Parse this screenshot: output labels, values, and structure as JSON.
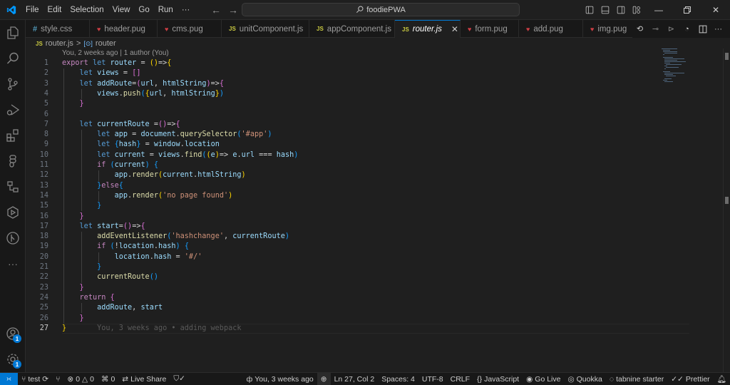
{
  "titlebar": {
    "menu": [
      "File",
      "Edit",
      "Selection",
      "View",
      "Go",
      "Run",
      "···"
    ],
    "search_text": "foodiePWA",
    "icons": [
      "toggle-primary-sidebar-icon",
      "toggle-panel-icon",
      "toggle-secondary-sidebar-icon",
      "customize-layout-icon",
      "minimize-icon",
      "restore-icon",
      "close-icon"
    ]
  },
  "activitybar": {
    "items": [
      "explorer",
      "search",
      "source-control",
      "run-and-debug",
      "extensions",
      "figma",
      "remote-explorer",
      "live-share-panel",
      "git-graph",
      "more"
    ],
    "accounts_badge": "1",
    "settings_badge": "1"
  },
  "tabs": [
    {
      "label": "style.css",
      "type": "css",
      "active": false
    },
    {
      "label": "header.pug",
      "type": "pug",
      "active": false
    },
    {
      "label": "cms.pug",
      "type": "pug",
      "active": false
    },
    {
      "label": "unitComponent.js",
      "type": "js",
      "active": false
    },
    {
      "label": "appComponent.js",
      "type": "js",
      "active": false
    },
    {
      "label": "router.js",
      "type": "js",
      "active": true
    },
    {
      "label": "form.pug",
      "type": "pug",
      "active": false
    },
    {
      "label": "add.pug",
      "type": "pug",
      "active": false
    },
    {
      "label": "img.pug",
      "type": "pug",
      "active": false
    }
  ],
  "tab_icon_text": {
    "js": "JS",
    "css": "#",
    "pug": "♥"
  },
  "breadcrumb": {
    "file": "router.js",
    "separator": ">",
    "symbol": "router"
  },
  "codelens": "You, 2 weeks ago | 1 author (You)",
  "editor": {
    "current_line": 27,
    "blame": "You, 3 weeks ago • adding webpack",
    "lines": [
      "export let router = ()=>{",
      "    let views = []",
      "    let addRoute=(url, htmlString)=>{",
      "        views.push({url, htmlString})",
      "    }",
      "",
      "    let currentRoute =()=>{",
      "        let app = document.querySelector('#app')",
      "        let {hash} = window.location",
      "        let current = views.find((e)=> e.url === hash)",
      "        if (current) {",
      "            app.render(current.htmlString)",
      "        }else{",
      "            app.render('no page found')",
      "        }",
      "    }",
      "    let start=()=>{",
      "        addEventListener('hashchange', currentRoute)",
      "        if (!location.hash) {",
      "            location.hash = '#/'",
      "        }",
      "        currentRoute()",
      "    }",
      "    return {",
      "        addRoute, start",
      "    }",
      "}"
    ]
  },
  "statusbar": {
    "branch": "test",
    "errors": "0",
    "warnings": "0",
    "ports": "0",
    "live_share": "Live Share",
    "blame": "You, 3 weeks ago",
    "position": "Ln 27, Col 2",
    "spaces": "Spaces: 4",
    "encoding": "UTF-8",
    "eol": "CRLF",
    "language": "JavaScript",
    "go_live": "Go Live",
    "quokka": "Quokka",
    "tabnine": "tabnine starter",
    "prettier": "Prettier"
  },
  "colors": {
    "accent": "#0078d4",
    "editor_bg": "#1f1f1f",
    "keyword": "#569cd6",
    "string": "#ce9178",
    "function": "#dcdcaa",
    "variable": "#9cdcfe"
  }
}
